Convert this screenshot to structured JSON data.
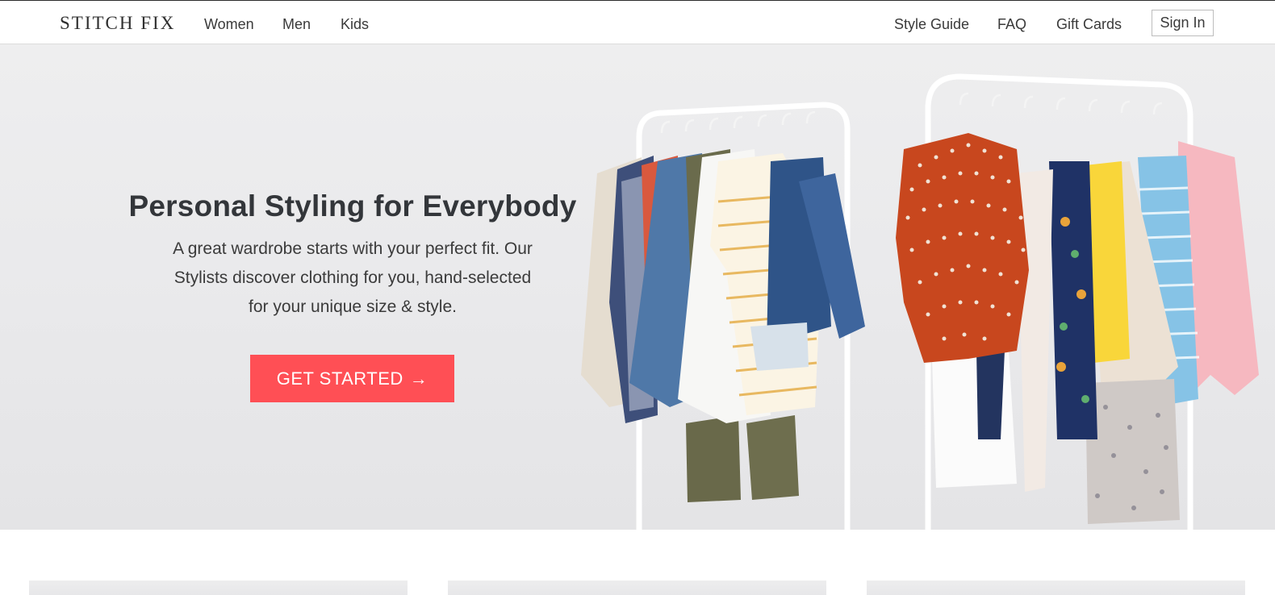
{
  "header": {
    "logo": "STITCH FIX",
    "nav_left": [
      "Women",
      "Men",
      "Kids"
    ],
    "nav_right": [
      "Style Guide",
      "FAQ",
      "Gift Cards"
    ],
    "signin_label": "Sign In"
  },
  "hero": {
    "title": "Personal Styling for Everybody",
    "description": "A great wardrobe starts with your perfect fit. Our Stylists discover clothing for you, hand-selected for your unique size & style.",
    "cta_label": "GET STARTED",
    "cta_icon": "arrow-right-icon",
    "image": "clothing-racks-photo"
  },
  "colors": {
    "accent": "#ff4f55",
    "hero_bg": "#ebebed",
    "text": "#33363a"
  }
}
